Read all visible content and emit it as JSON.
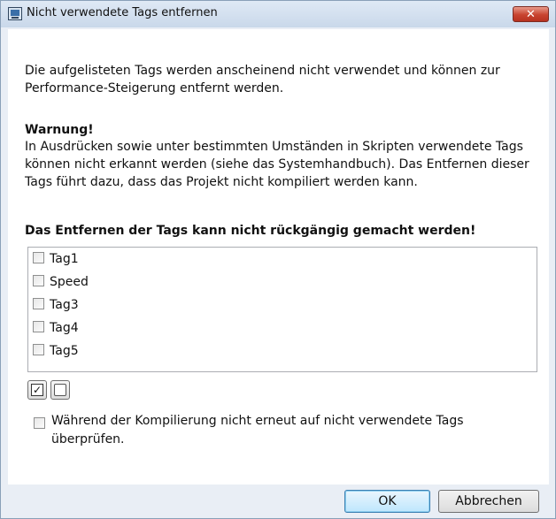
{
  "window": {
    "title": "Nicht verwendete Tags entfernen",
    "close_symbol": "✕"
  },
  "intro_text": "Die aufgelisteten Tags werden anscheinend nicht verwendet und können zur Performance-Steigerung entfernt werden.",
  "warning": {
    "heading": "Warnung!",
    "body": "In Ausdrücken sowie unter bestimmten Umständen in Skripten verwendete Tags können nicht erkannt werden (siehe das Systemhandbuch). Das Entfernen dieser Tags führt dazu, dass das Projekt nicht kompiliert werden kann.",
    "irreversible": "Das Entfernen der Tags kann nicht rückgängig gemacht werden!"
  },
  "tags": [
    {
      "label": "Tag1",
      "checked": false
    },
    {
      "label": "Speed",
      "checked": false
    },
    {
      "label": "Tag3",
      "checked": false
    },
    {
      "label": "Tag4",
      "checked": false
    },
    {
      "label": "Tag5",
      "checked": false
    }
  ],
  "select_all_symbol": "✓",
  "skip_check": {
    "label": "Während der Kompilierung nicht erneut auf nicht verwendete Tags überprüfen.",
    "checked": false
  },
  "buttons": {
    "ok": "OK",
    "cancel": "Abbrechen"
  }
}
